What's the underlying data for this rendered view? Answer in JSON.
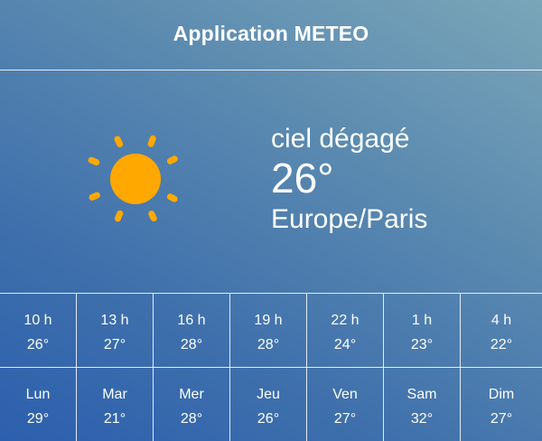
{
  "app": {
    "title": "Application METEO"
  },
  "current": {
    "icon": "sun-icon",
    "condition": "ciel dégagé",
    "temperature": "26°",
    "location": "Europe/Paris"
  },
  "colors": {
    "sun": "#ffa800",
    "text": "#ffffff",
    "gradient_light": "#7aa6b8",
    "gradient_dark": "#2c5fae"
  },
  "hourly": [
    {
      "time": "10 h",
      "temp": "26°"
    },
    {
      "time": "13 h",
      "temp": "27°"
    },
    {
      "time": "16 h",
      "temp": "28°"
    },
    {
      "time": "19 h",
      "temp": "28°"
    },
    {
      "time": "22 h",
      "temp": "24°"
    },
    {
      "time": "1 h",
      "temp": "23°"
    },
    {
      "time": "4 h",
      "temp": "22°"
    }
  ],
  "daily": [
    {
      "day": "Lun",
      "temp": "29°"
    },
    {
      "day": "Mar",
      "temp": "21°"
    },
    {
      "day": "Mer",
      "temp": "28°"
    },
    {
      "day": "Jeu",
      "temp": "26°"
    },
    {
      "day": "Ven",
      "temp": "27°"
    },
    {
      "day": "Sam",
      "temp": "32°"
    },
    {
      "day": "Dim",
      "temp": "27°"
    }
  ]
}
